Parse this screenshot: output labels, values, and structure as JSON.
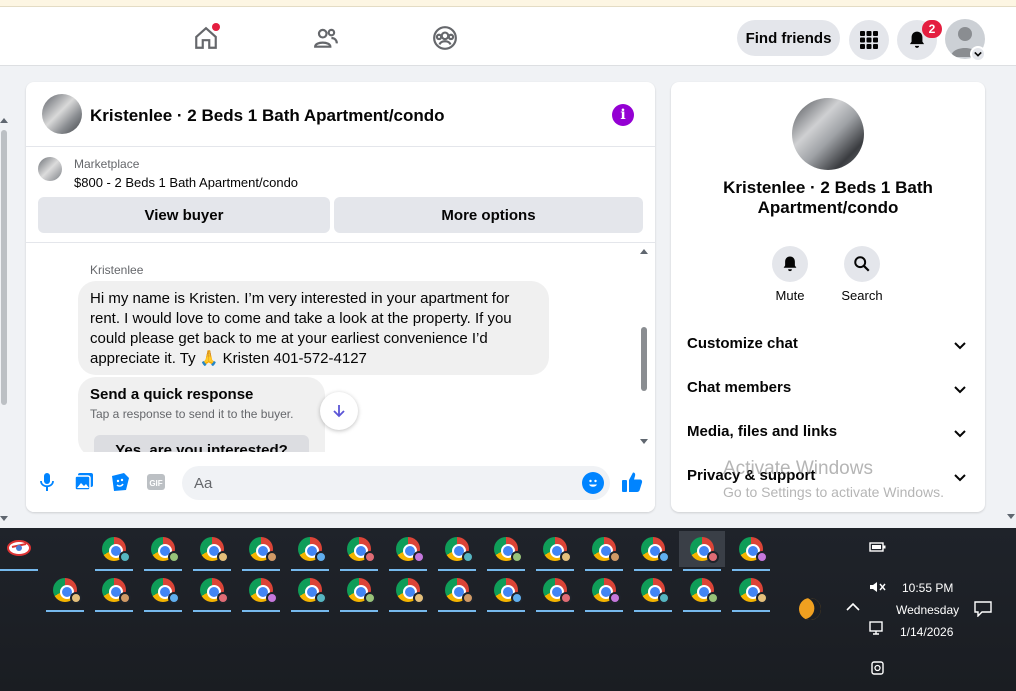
{
  "topnav": {
    "find_friends_label": "Find friends",
    "notification_count": "2",
    "tabs": [
      "home-icon",
      "friends-icon",
      "groups-icon"
    ]
  },
  "chat": {
    "title": "Kristenlee · 2 Beds 1 Bath Apartment/condo",
    "marketplace_label": "Marketplace",
    "listing": "$800 - 2 Beds 1 Bath Apartment/condo",
    "view_buyer_label": "View buyer",
    "more_options_label": "More options",
    "sender_name": "Kristenlee",
    "message_text": "Hi my name is Kristen. I’m very interested in your apartment for rent. I would love to come and take a look at the property. If you could please get back to me at your earliest convenience I’d appreciate it. Ty 🙏 Kristen 401-572-4127",
    "quick_response_title": "Send a quick response",
    "quick_response_sub": "Tap a response to send it to the buyer.",
    "quick_response_option": "Yes, are you interested?",
    "composer_placeholder": "Aa",
    "gif_label": "GIF"
  },
  "info": {
    "title": "Kristenlee · 2 Beds 1 Bath Apartment/condo",
    "mute_label": "Mute",
    "search_label": "Search",
    "sections": [
      "Customize chat",
      "Chat members",
      "Media, files and links",
      "Privacy & support"
    ]
  },
  "watermark": {
    "line1": "Activate Windows",
    "line2": "Go to Settings to activate Windows."
  },
  "tray": {
    "time": "10:55 PM",
    "day": "Wednesday",
    "date": "1/14/2026"
  },
  "colors": {
    "brand_blue": "#0084ff",
    "info_purple": "#9400d3",
    "badge_red": "#e41e3f"
  }
}
